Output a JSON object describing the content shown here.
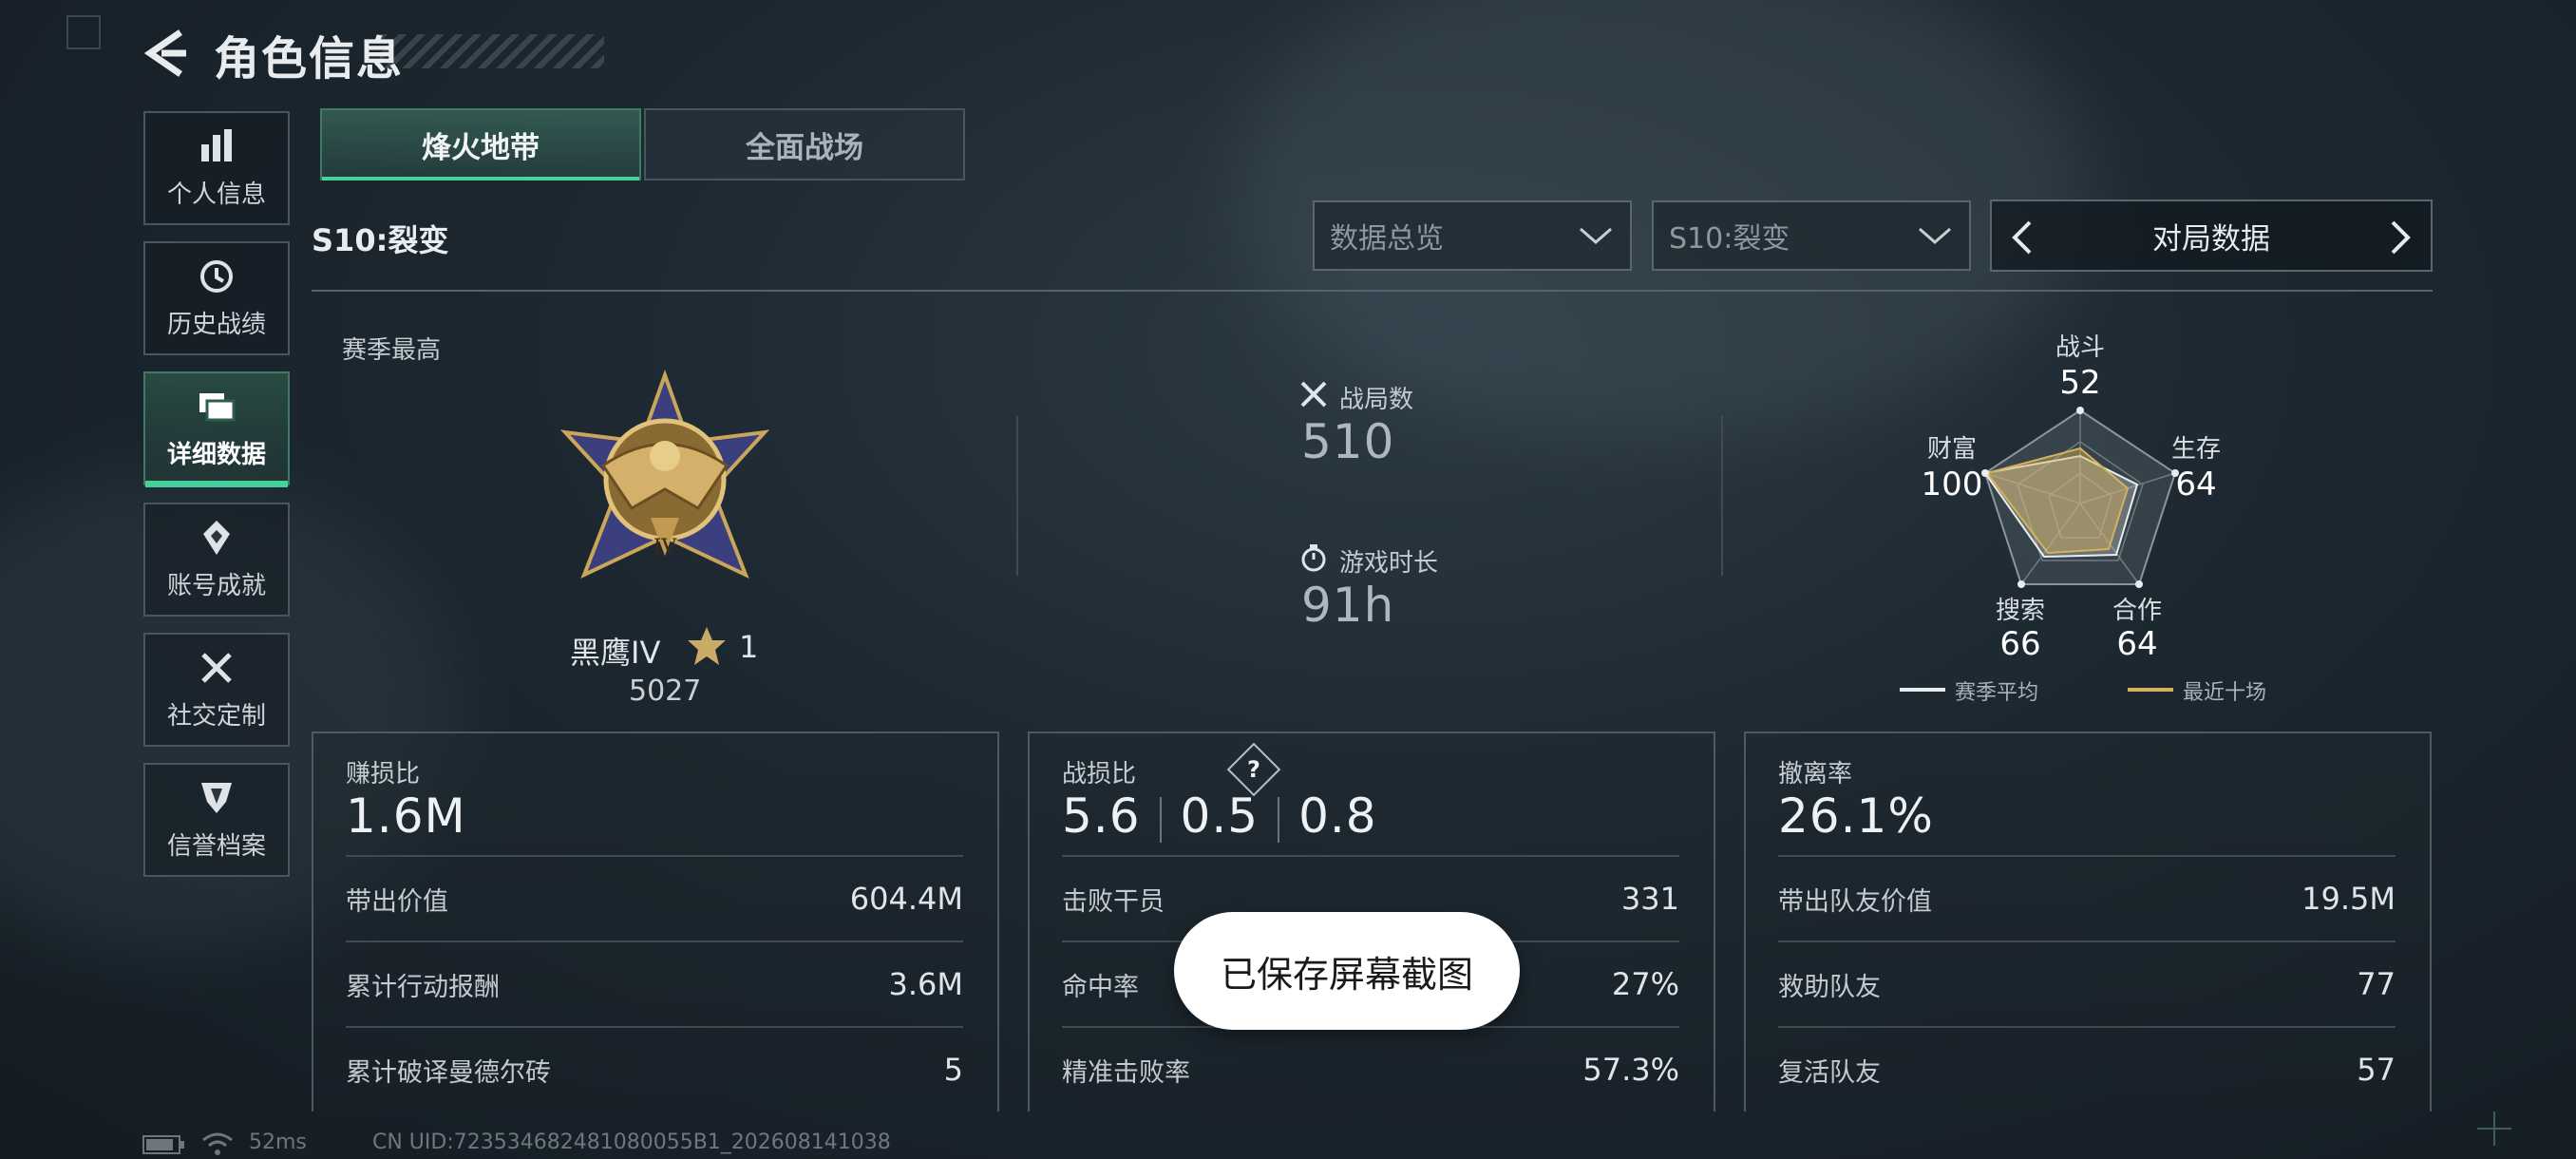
{
  "header": {
    "title": "角色信息"
  },
  "sidebar": {
    "items": [
      {
        "label": "个人信息",
        "icon": "bar-chart-icon"
      },
      {
        "label": "历史战绩",
        "icon": "history-clock-icon"
      },
      {
        "label": "详细数据",
        "icon": "folder-icon",
        "active": true
      },
      {
        "label": "账号成就",
        "icon": "achievement-icon"
      },
      {
        "label": "社交定制",
        "icon": "tools-icon"
      },
      {
        "label": "信誉档案",
        "icon": "credit-shield-icon"
      }
    ]
  },
  "mode_tabs": [
    {
      "label": "烽火地带",
      "active": true
    },
    {
      "label": "全面战场",
      "active": false
    }
  ],
  "season_label": "S10:裂变",
  "filters": {
    "view_select": "数据总览",
    "season_select": "S10:裂变",
    "pager_label": "对局数据"
  },
  "summary": {
    "season_best_label": "赛季最高",
    "rank": {
      "name": "黑鹰IV",
      "stars": "1",
      "score": "5027"
    },
    "matches": {
      "label": "战局数",
      "value": "510"
    },
    "playtime": {
      "label": "游戏时长",
      "value": "91h"
    }
  },
  "radar": {
    "axes": [
      {
        "label": "战斗",
        "value": "52"
      },
      {
        "label": "生存",
        "value": "64"
      },
      {
        "label": "合作",
        "value": "64"
      },
      {
        "label": "搜索",
        "value": "66"
      },
      {
        "label": "财富",
        "value": "100"
      }
    ],
    "legend": [
      {
        "label": "赛季平均",
        "color": "#e9edef"
      },
      {
        "label": "最近十场",
        "color": "#d4b25c"
      }
    ]
  },
  "cards": {
    "profit": {
      "title": "赚损比",
      "value": "1.6M",
      "rows": [
        {
          "label": "带出价值",
          "value": "604.4M"
        },
        {
          "label": "累计行动报酬",
          "value": "3.6M"
        },
        {
          "label": "累计破译曼德尔砖",
          "value": "5"
        }
      ]
    },
    "combat": {
      "title": "战损比",
      "help": "?",
      "values": [
        "5.6",
        "0.5",
        "0.8"
      ],
      "rows": [
        {
          "label": "击败干员",
          "value": "331"
        },
        {
          "label": "命中率",
          "value": "27%"
        },
        {
          "label": "精准击败率",
          "value": "57.3%"
        }
      ]
    },
    "extract": {
      "title": "撤离率",
      "value": "26.1%",
      "rows": [
        {
          "label": "带出队友价值",
          "value": "19.5M"
        },
        {
          "label": "救助队友",
          "value": "77"
        },
        {
          "label": "复活队友",
          "value": "57"
        }
      ]
    }
  },
  "toast": "已保存屏幕截图",
  "status_bar": {
    "ping": "52ms",
    "uid": "CN UID:723534682481080055B1_202608141038"
  },
  "colors": {
    "accent": "#46d19a",
    "radar_recent": "#d4b25c"
  }
}
